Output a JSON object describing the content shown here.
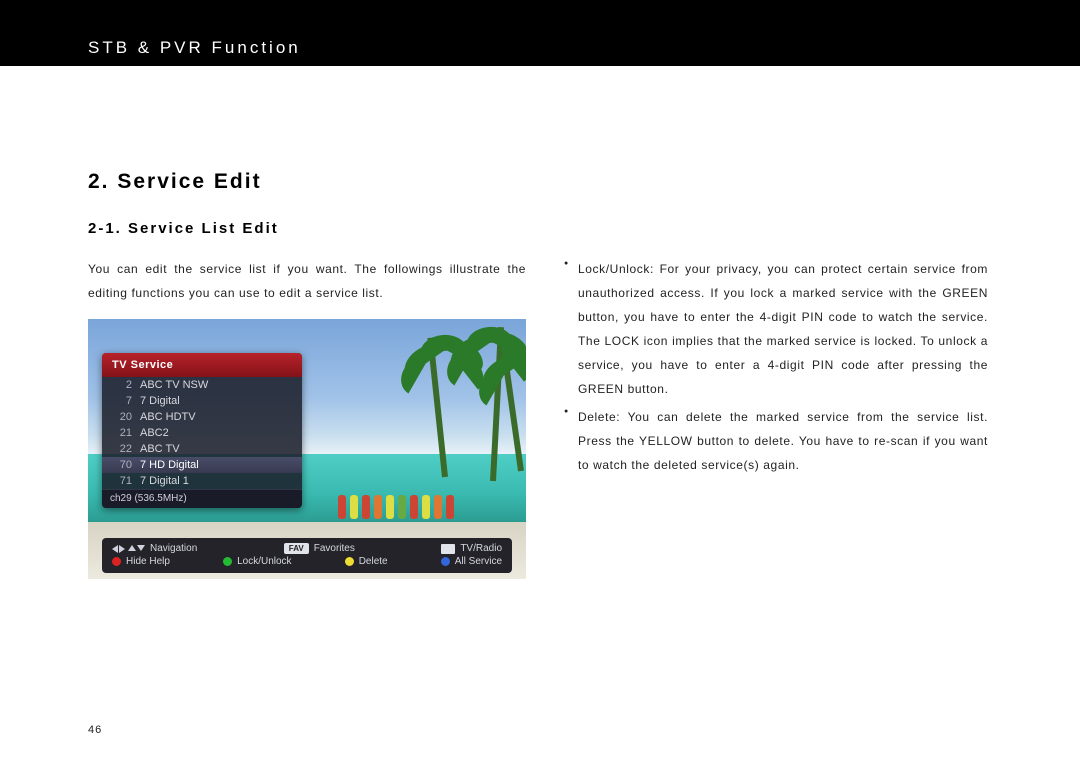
{
  "header": {
    "title": "STB & PVR Function"
  },
  "section": {
    "heading": "2. Service Edit",
    "subheading": "2-1. Service List Edit",
    "intro": "You can edit the service list if you want. The followings illustrate the editing functions you can use to edit a service list."
  },
  "bullets": [
    "Lock/Unlock: For your privacy, you can protect certain service from unauthorized access. If you lock a marked service with the GREEN button, you have to enter the 4-digit PIN code to watch the service. The LOCK icon implies that the marked service is locked. To unlock a service, you have to enter a 4-digit PIN code after pressing the GREEN button.",
    "Delete: You can delete the marked service from the service list. Press the YELLOW button to delete. You have to re-scan if you want to watch the deleted service(s) again."
  ],
  "osd": {
    "title": "TV Service",
    "rows": [
      {
        "ch": "2",
        "name": "ABC TV NSW"
      },
      {
        "ch": "7",
        "name": "7 Digital"
      },
      {
        "ch": "20",
        "name": "ABC HDTV"
      },
      {
        "ch": "21",
        "name": "ABC2"
      },
      {
        "ch": "22",
        "name": "ABC TV"
      },
      {
        "ch": "70",
        "name": "7 HD Digital"
      },
      {
        "ch": "71",
        "name": "7 Digital 1"
      }
    ],
    "selected_index": 5,
    "footer": "ch29  (536.5MHz)"
  },
  "help": {
    "row1": {
      "navigation": "Navigation",
      "fav_pill": "FAV",
      "favorites": "Favorites",
      "tvradio": "TV/Radio"
    },
    "row2": {
      "hide_help": "Hide Help",
      "lock_unlock": "Lock/Unlock",
      "delete": "Delete",
      "all_service": "All Service"
    }
  },
  "page_number": "46"
}
